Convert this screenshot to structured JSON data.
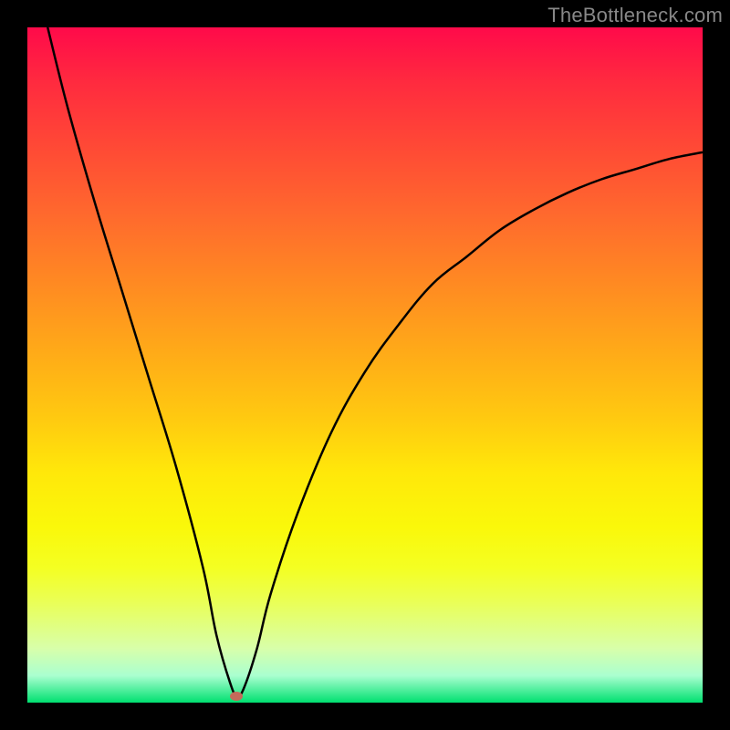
{
  "watermark": "TheBottleneck.com",
  "chart_data": {
    "type": "line",
    "title": "",
    "xlabel": "",
    "ylabel": "",
    "xlim": [
      0,
      100
    ],
    "ylim": [
      0,
      100
    ],
    "grid": false,
    "legend": false,
    "series": [
      {
        "name": "bottleneck-curve",
        "x": [
          3,
          6,
          10,
          14,
          18,
          22,
          26,
          28,
          30,
          31,
          32,
          34,
          36,
          40,
          45,
          50,
          55,
          60,
          65,
          70,
          75,
          80,
          85,
          90,
          95,
          100
        ],
        "y": [
          100,
          88,
          74,
          61,
          48,
          35,
          20,
          10,
          3,
          1,
          2,
          8,
          16,
          28,
          40,
          49,
          56,
          62,
          66,
          70,
          73,
          75.5,
          77.5,
          79,
          80.5,
          81.5
        ]
      }
    ],
    "marker": {
      "x": 31,
      "y": 1,
      "color": "#c46a5a"
    },
    "background_gradient": {
      "type": "vertical",
      "stops": [
        {
          "pos": 0.0,
          "color": "#ff0a4a"
        },
        {
          "pos": 0.5,
          "color": "#ffaa18"
        },
        {
          "pos": 0.75,
          "color": "#faf80a"
        },
        {
          "pos": 1.0,
          "color": "#00e070"
        }
      ]
    }
  }
}
